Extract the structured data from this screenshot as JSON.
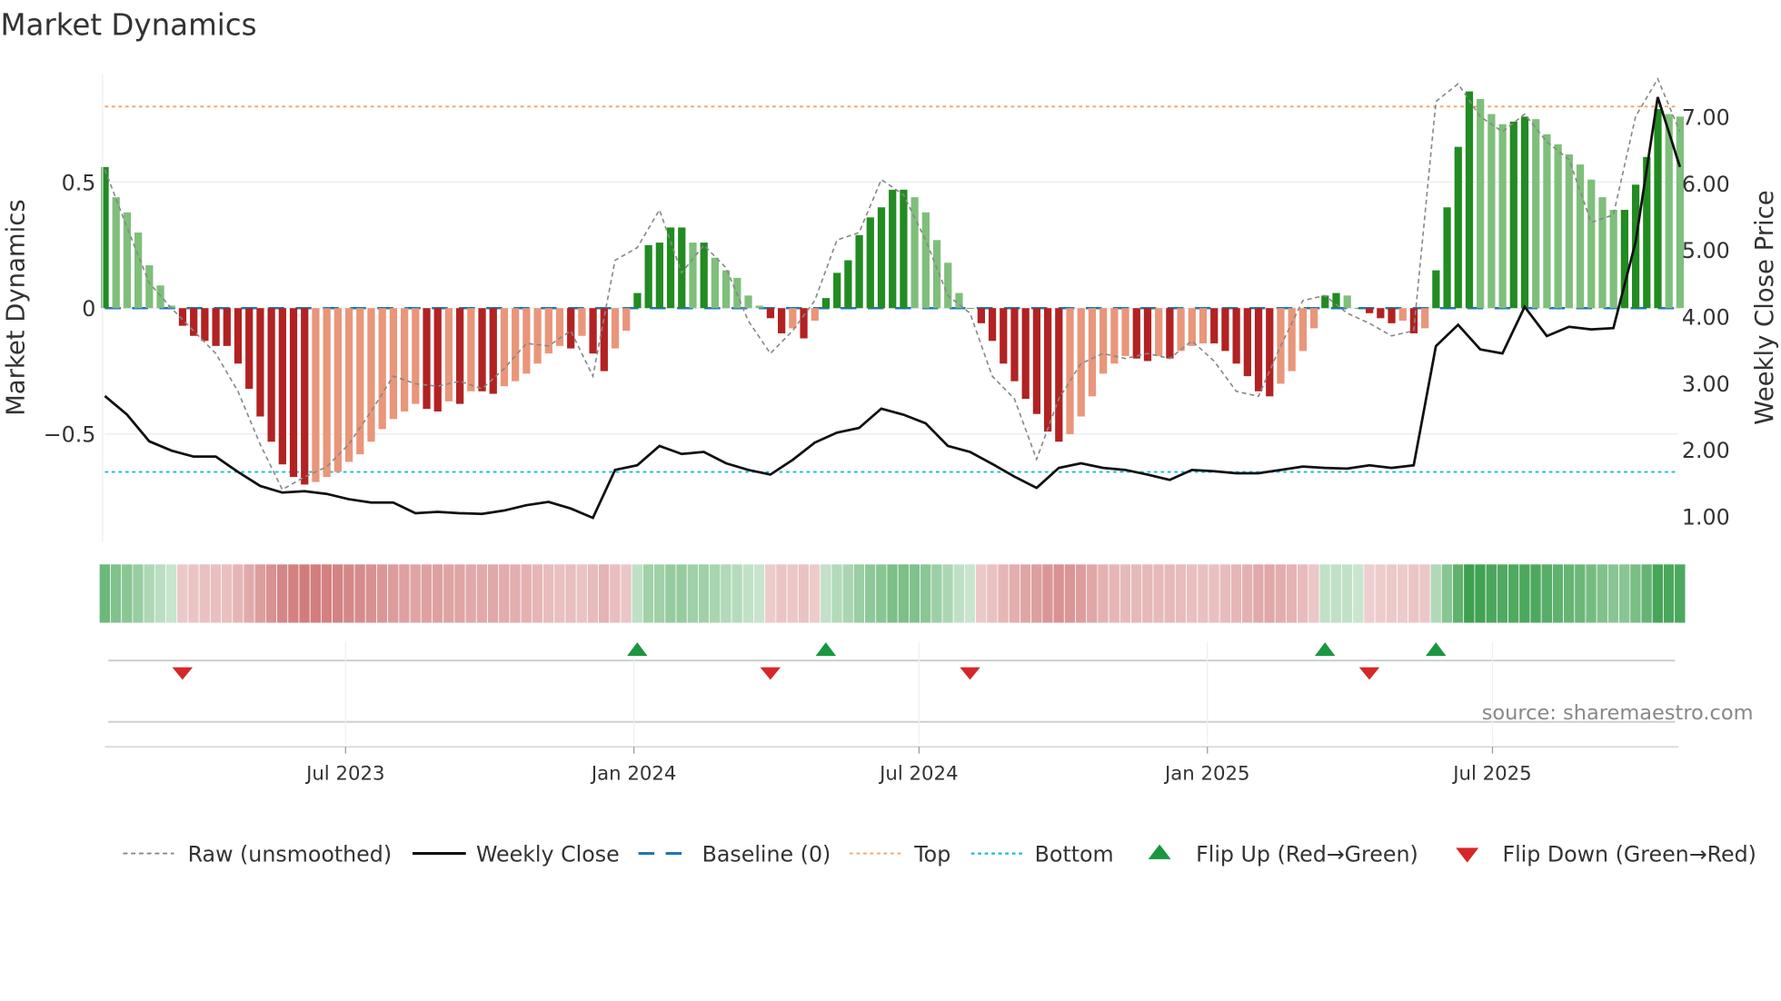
{
  "chart_data": {
    "type": "bar",
    "title": "Market Dynamics",
    "ylabel": "Market Dynamics",
    "ylabel_right": "Weekly Close Price",
    "ylim": [
      -0.93,
      0.93
    ],
    "ylim_right": [
      0.61,
      7.65
    ],
    "yticks": [
      {
        "v": 0.5,
        "label": "0.5"
      },
      {
        "v": 0,
        "label": "0"
      },
      {
        "v": -0.5,
        "label": "−0.5"
      }
    ],
    "yticks_right": [
      {
        "v": 7,
        "label": "7.00"
      },
      {
        "v": 6,
        "label": "6.00"
      },
      {
        "v": 5,
        "label": "5.00"
      },
      {
        "v": 4,
        "label": "4.00"
      },
      {
        "v": 3,
        "label": "3.00"
      },
      {
        "v": 2,
        "label": "2.00"
      },
      {
        "v": 1,
        "label": "1.00"
      }
    ],
    "xticks": [
      {
        "week": 21.7,
        "label": "Jul 2023"
      },
      {
        "week": 47.7,
        "label": "Jan 2024"
      },
      {
        "week": 73.4,
        "label": "Jul 2024"
      },
      {
        "week": 99.4,
        "label": "Jan 2025"
      },
      {
        "week": 125.1,
        "label": "Jul 2025"
      }
    ],
    "dynamics": [
      0.56,
      0.44,
      0.38,
      0.3,
      0.17,
      0.09,
      0.01,
      -0.07,
      -0.11,
      -0.13,
      -0.15,
      -0.15,
      -0.22,
      -0.32,
      -0.43,
      -0.53,
      -0.62,
      -0.67,
      -0.7,
      -0.69,
      -0.67,
      -0.65,
      -0.61,
      -0.58,
      -0.53,
      -0.48,
      -0.44,
      -0.41,
      -0.38,
      -0.4,
      -0.41,
      -0.37,
      -0.38,
      -0.33,
      -0.33,
      -0.34,
      -0.31,
      -0.29,
      -0.26,
      -0.22,
      -0.18,
      -0.15,
      -0.16,
      -0.11,
      -0.18,
      -0.25,
      -0.16,
      -0.09,
      0.06,
      0.25,
      0.26,
      0.32,
      0.32,
      0.26,
      0.26,
      0.2,
      0.15,
      0.12,
      0.05,
      0.01,
      -0.04,
      -0.1,
      -0.08,
      -0.12,
      -0.05,
      0.04,
      0.14,
      0.19,
      0.29,
      0.36,
      0.4,
      0.47,
      0.47,
      0.44,
      0.38,
      0.27,
      0.18,
      0.06,
      0.0,
      -0.06,
      -0.13,
      -0.22,
      -0.29,
      -0.36,
      -0.42,
      -0.49,
      -0.53,
      -0.5,
      -0.43,
      -0.35,
      -0.26,
      -0.22,
      -0.19,
      -0.2,
      -0.21,
      -0.19,
      -0.2,
      -0.17,
      -0.15,
      -0.14,
      -0.14,
      -0.17,
      -0.22,
      -0.27,
      -0.33,
      -0.35,
      -0.3,
      -0.25,
      -0.17,
      -0.08,
      0.05,
      0.06,
      0.05,
      0.0,
      -0.02,
      -0.04,
      -0.06,
      -0.05,
      -0.1,
      -0.08,
      0.15,
      0.4,
      0.64,
      0.86,
      0.83,
      0.77,
      0.73,
      0.74,
      0.76,
      0.75,
      0.69,
      0.65,
      0.61,
      0.57,
      0.51,
      0.44,
      0.39,
      0.39,
      0.49,
      0.6,
      0.79,
      0.77,
      0.76
    ],
    "raw_step_weeks": 2,
    "raw": [
      0.55,
      0.32,
      0.1,
      0.0,
      -0.09,
      -0.18,
      -0.33,
      -0.54,
      -0.72,
      -0.67,
      -0.63,
      -0.54,
      -0.41,
      -0.27,
      -0.3,
      -0.31,
      -0.29,
      -0.32,
      -0.24,
      -0.14,
      -0.15,
      -0.09,
      -0.27,
      0.19,
      0.24,
      0.39,
      0.14,
      0.25,
      0.16,
      -0.05,
      -0.18,
      -0.09,
      0.03,
      0.27,
      0.3,
      0.51,
      0.45,
      0.27,
      0.05,
      -0.02,
      -0.27,
      -0.36,
      -0.6,
      -0.36,
      -0.22,
      -0.18,
      -0.2,
      -0.18,
      -0.2,
      -0.13,
      -0.21,
      -0.33,
      -0.35,
      -0.15,
      0.03,
      0.05,
      -0.02,
      -0.06,
      -0.11,
      -0.09,
      0.82,
      0.89,
      0.76,
      0.7,
      0.77,
      0.66,
      0.59,
      0.34,
      0.37,
      0.76,
      0.91,
      0.7
    ],
    "close_step_weeks": 2,
    "weekly_close": [
      2.81,
      2.53,
      2.13,
      1.99,
      1.9,
      1.9,
      1.67,
      1.46,
      1.36,
      1.38,
      1.34,
      1.26,
      1.21,
      1.21,
      1.05,
      1.07,
      1.05,
      1.04,
      1.09,
      1.17,
      1.22,
      1.12,
      0.98,
      1.7,
      1.77,
      2.06,
      1.94,
      1.97,
      1.8,
      1.7,
      1.63,
      1.85,
      2.11,
      2.26,
      2.33,
      2.62,
      2.53,
      2.4,
      2.06,
      1.97,
      1.79,
      1.6,
      1.43,
      1.73,
      1.8,
      1.73,
      1.7,
      1.63,
      1.55,
      1.7,
      1.68,
      1.65,
      1.65,
      1.7,
      1.75,
      1.73,
      1.72,
      1.77,
      1.73,
      1.77,
      3.56,
      3.88,
      3.51,
      3.45,
      4.15,
      3.71,
      3.85,
      3.81,
      3.83,
      5.12,
      7.3,
      6.25
    ],
    "baseline": 0,
    "top": 0.8,
    "bottom": -0.65,
    "flip_up_weeks": [
      48,
      65,
      110,
      120
    ],
    "flip_down_weeks": [
      7,
      60,
      78,
      114
    ],
    "colors": {
      "dark_green": "#228b22",
      "light_green": "#7fbf7b",
      "dark_red": "#b22222",
      "light_red": "#e9967a",
      "close": "#111111",
      "raw": "#888888",
      "baseline": "#1f77b4",
      "top": "#f4a460",
      "bottom": "#17becf",
      "flip_up": "#1a9641",
      "flip_down": "#d62728"
    },
    "legend": {
      "raw": "Raw (unsmoothed)",
      "close": "Weekly Close",
      "baseline": "Baseline (0)",
      "top": "Top",
      "bottom": "Bottom",
      "flip_up": "Flip Up (Red→Green)",
      "flip_down": "Flip Down (Green→Red)"
    },
    "source": "source: sharemaestro.com"
  }
}
